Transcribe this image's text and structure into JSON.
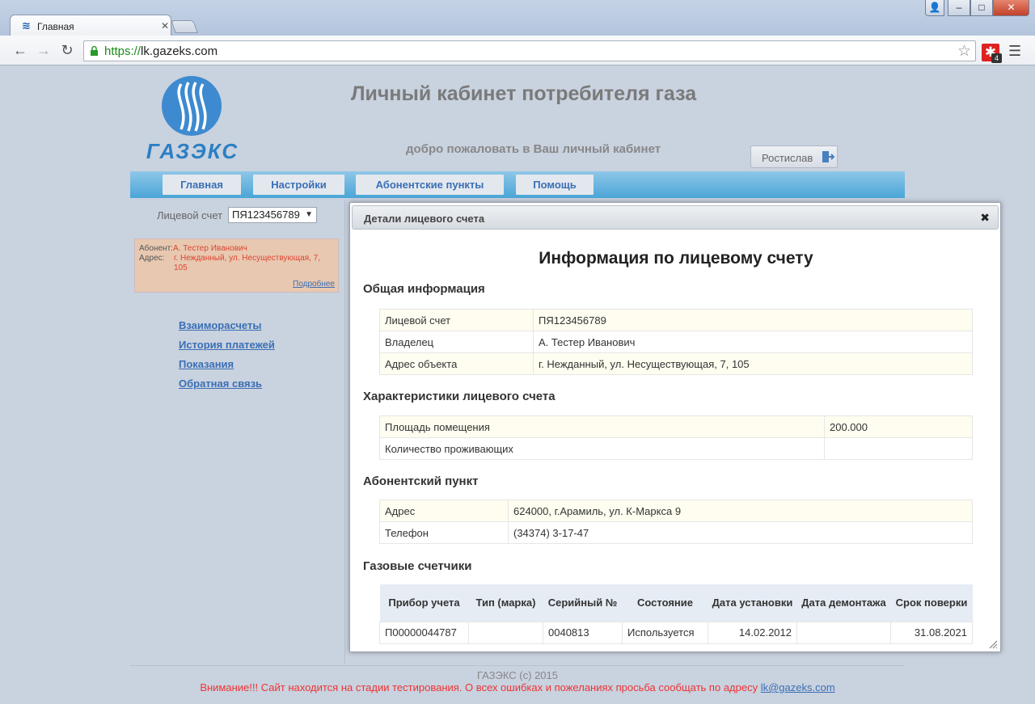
{
  "browser": {
    "tab_title": "Главная",
    "url_scheme": "https://",
    "url_host": "lk.gazeks.com",
    "extension_badge": "4",
    "icons": {
      "back": "arrow-left-icon",
      "forward": "arrow-right-icon",
      "reload": "reload-icon",
      "lock": "lock-icon",
      "star": "star-icon",
      "extension": "extension-icon",
      "menu": "hamburger-menu-icon"
    }
  },
  "header": {
    "logo_text": "ГАЗЭКС",
    "title": "Личный кабинет потребителя газа",
    "welcome": "добро пожаловать в Ваш личный кабинет",
    "user_name": "Ростислав"
  },
  "nav": {
    "items": [
      {
        "label": "Главная"
      },
      {
        "label": "Настройки"
      },
      {
        "label": "Абонентские пункты"
      },
      {
        "label": "Помощь"
      }
    ]
  },
  "sidebar": {
    "account_label": "Лицевой счет",
    "account_value": "ПЯ123456789",
    "subscriber_key": "Абонент:",
    "subscriber_name": "А. Тестер Иванович",
    "address_key": "Адрес:",
    "address_value": "г. Нежданный, ул. Несуществующая, 7, 105",
    "more_link": "Подробнее",
    "links": [
      {
        "label": "Взаиморасчеты"
      },
      {
        "label": "История платежей"
      },
      {
        "label": "Показания"
      },
      {
        "label": "Обратная связь"
      }
    ]
  },
  "dialog": {
    "title": "Детали лицевого счета",
    "heading": "Информация по лицевому счету",
    "general": {
      "title": "Общая информация",
      "rows": [
        {
          "label": "Лицевой счет",
          "value": "ПЯ123456789"
        },
        {
          "label": "Владелец",
          "value": "А. Тестер Иванович"
        },
        {
          "label": "Адрес объекта",
          "value": "г. Нежданный, ул. Несуществующая, 7, 105"
        }
      ]
    },
    "characteristics": {
      "title": "Характеристики лицевого счета",
      "rows": [
        {
          "label": "Площадь помещения",
          "value": "200.000"
        },
        {
          "label": "Количество проживающих",
          "value": ""
        }
      ]
    },
    "subscriber_point": {
      "title": "Абонентский пункт",
      "rows": [
        {
          "label": "Адрес",
          "value": "624000, г.Арамиль, ул. К-Маркса 9"
        },
        {
          "label": "Телефон",
          "value": "(34374) 3-17-47"
        }
      ]
    },
    "meters": {
      "title": "Газовые счетчики",
      "headers": [
        "Прибор учета",
        "Тип (марка)",
        "Серийный №",
        "Состояние",
        "Дата установки",
        "Дата демонтажа",
        "Срок поверки"
      ],
      "rows": [
        [
          "П00000044787",
          "",
          "0040813",
          "Используется",
          "14.02.2012",
          "",
          "31.08.2021"
        ]
      ]
    }
  },
  "footer": {
    "copyright": "ГАЗЭКС (с) 2015",
    "warning": "Внимание!!! Сайт находится на стадии тестирования. О всех ошибках и пожеланиях просьба сообщать по адресу ",
    "email": "lk@gazeks.com"
  },
  "colors": {
    "accent_blue": "#3a6fb5",
    "navbar": "#4aa6d7",
    "warning_red": "#e33"
  }
}
